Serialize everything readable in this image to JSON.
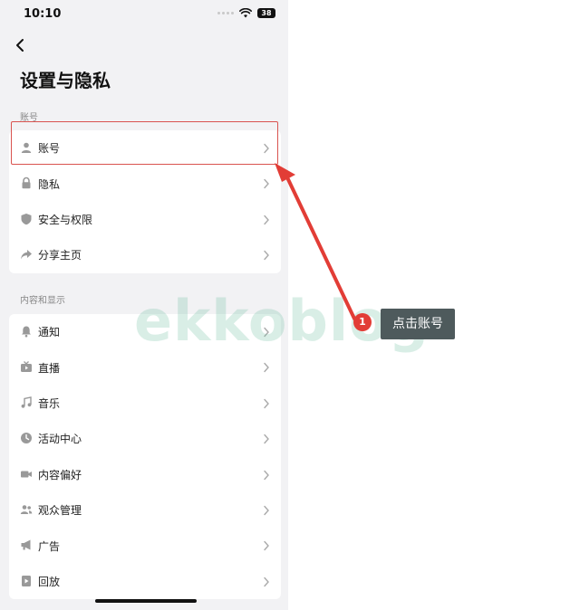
{
  "status_bar": {
    "time": "10:10",
    "battery": "38"
  },
  "header": {
    "title": "设置与隐私"
  },
  "sections": [
    {
      "title": "账号",
      "items": [
        {
          "label": "账号",
          "icon": "person-icon"
        },
        {
          "label": "隐私",
          "icon": "lock-icon"
        },
        {
          "label": "安全与权限",
          "icon": "shield-icon"
        },
        {
          "label": "分享主页",
          "icon": "share-icon"
        }
      ]
    },
    {
      "title": "内容和显示",
      "items": [
        {
          "label": "通知",
          "icon": "bell-icon"
        },
        {
          "label": "直播",
          "icon": "tv-icon"
        },
        {
          "label": "音乐",
          "icon": "music-note-icon"
        },
        {
          "label": "活动中心",
          "icon": "clock-icon"
        },
        {
          "label": "内容偏好",
          "icon": "video-camera-icon"
        },
        {
          "label": "观众管理",
          "icon": "people-icon"
        },
        {
          "label": "广告",
          "icon": "megaphone-icon"
        },
        {
          "label": "回放",
          "icon": "playback-icon"
        }
      ]
    }
  ],
  "annotation": {
    "step_number": "1",
    "tooltip_text": "点击账号",
    "accent_color": "#e23d36"
  },
  "watermark": {
    "text": "ekkoblog"
  }
}
